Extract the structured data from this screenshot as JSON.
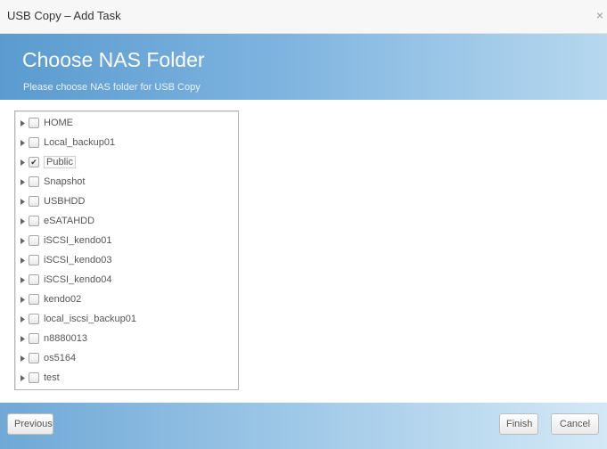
{
  "window": {
    "title": "USB Copy – Add Task",
    "close_glyph": "×"
  },
  "banner": {
    "heading": "Choose NAS Folder",
    "subheading": "Please choose NAS folder for USB Copy"
  },
  "tree": {
    "items": [
      {
        "label": "HOME",
        "checked": false
      },
      {
        "label": "Local_backup01",
        "checked": false
      },
      {
        "label": "Public",
        "checked": true
      },
      {
        "label": "Snapshot",
        "checked": false
      },
      {
        "label": "USBHDD",
        "checked": false
      },
      {
        "label": "eSATAHDD",
        "checked": false
      },
      {
        "label": "iSCSI_kendo01",
        "checked": false
      },
      {
        "label": "iSCSI_kendo03",
        "checked": false
      },
      {
        "label": "iSCSI_kendo04",
        "checked": false
      },
      {
        "label": "kendo02",
        "checked": false
      },
      {
        "label": "local_iscsi_backup01",
        "checked": false
      },
      {
        "label": "n8880013",
        "checked": false
      },
      {
        "label": "os5164",
        "checked": false
      },
      {
        "label": "test",
        "checked": false
      }
    ],
    "expander_icon": "triangle-right-icon",
    "check_glyph": "✔"
  },
  "footer": {
    "previous_label": "Previous",
    "finish_label": "Finish",
    "cancel_label": "Cancel"
  }
}
